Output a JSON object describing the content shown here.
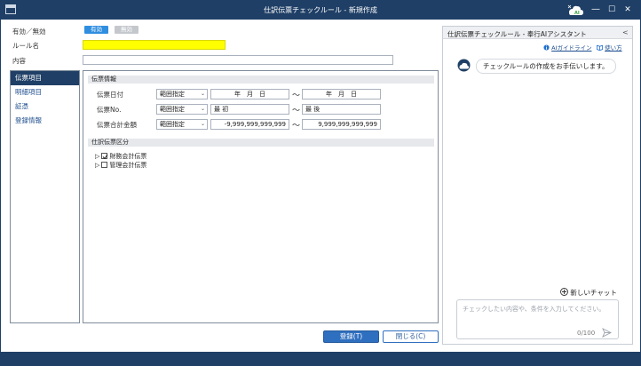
{
  "window": {
    "title": "仕訳伝票チェックルール - 新規作成",
    "min_glyph": "—",
    "max_glyph": "☐",
    "close_glyph": "✕"
  },
  "header": {
    "active_label": "有効／無効",
    "toggle_on": "有効",
    "toggle_off": "無効",
    "rule_name_label": "ルール名",
    "rule_name_value": "",
    "content_label": "内容",
    "content_value": ""
  },
  "nav": {
    "items": [
      {
        "label": "伝票項目",
        "active": true
      },
      {
        "label": "明細項目",
        "active": false
      },
      {
        "label": "証憑",
        "active": false
      },
      {
        "label": "登録情報",
        "active": false
      }
    ]
  },
  "form": {
    "section1": "伝票情報",
    "rows": [
      {
        "label": "伝票日付",
        "range": "範囲指定",
        "from": "年　月　日",
        "to": "年　月　日"
      },
      {
        "label": "伝票No.",
        "range": "範囲指定",
        "from": "最 初",
        "to": "最 後"
      },
      {
        "label": "伝票合計金額",
        "range": "範囲指定",
        "from": "-9,999,999,999,999",
        "to": "9,999,999,999,999"
      }
    ],
    "tilde": "～",
    "section2": "仕訳伝票区分",
    "tree": [
      {
        "label": "財務会計伝票",
        "checked": true
      },
      {
        "label": "管理会計伝票",
        "checked": false
      }
    ]
  },
  "buttons": {
    "register": "登録(T)",
    "close": "閉じる(C)"
  },
  "assistant": {
    "title": "仕訳伝票チェックルール - 奉行AIアシスタント",
    "collapse_glyph": "<",
    "guide_link": "AIガイドライン",
    "howto_link": "使い方",
    "message": "チェックルールの作成をお手伝いします。",
    "new_chat": "新しいチャット",
    "input_placeholder": "チェックしたい内容や、条件を入力してください。",
    "counter": "0/100"
  },
  "colors": {
    "titlebar": "#1f3f66",
    "toggle_on": "#2f8ee0",
    "toggle_off": "#c4c8cd",
    "rule_name_fill": "#ffff00",
    "nav_active": "#1f3f66",
    "link": "#1f4f8f"
  }
}
